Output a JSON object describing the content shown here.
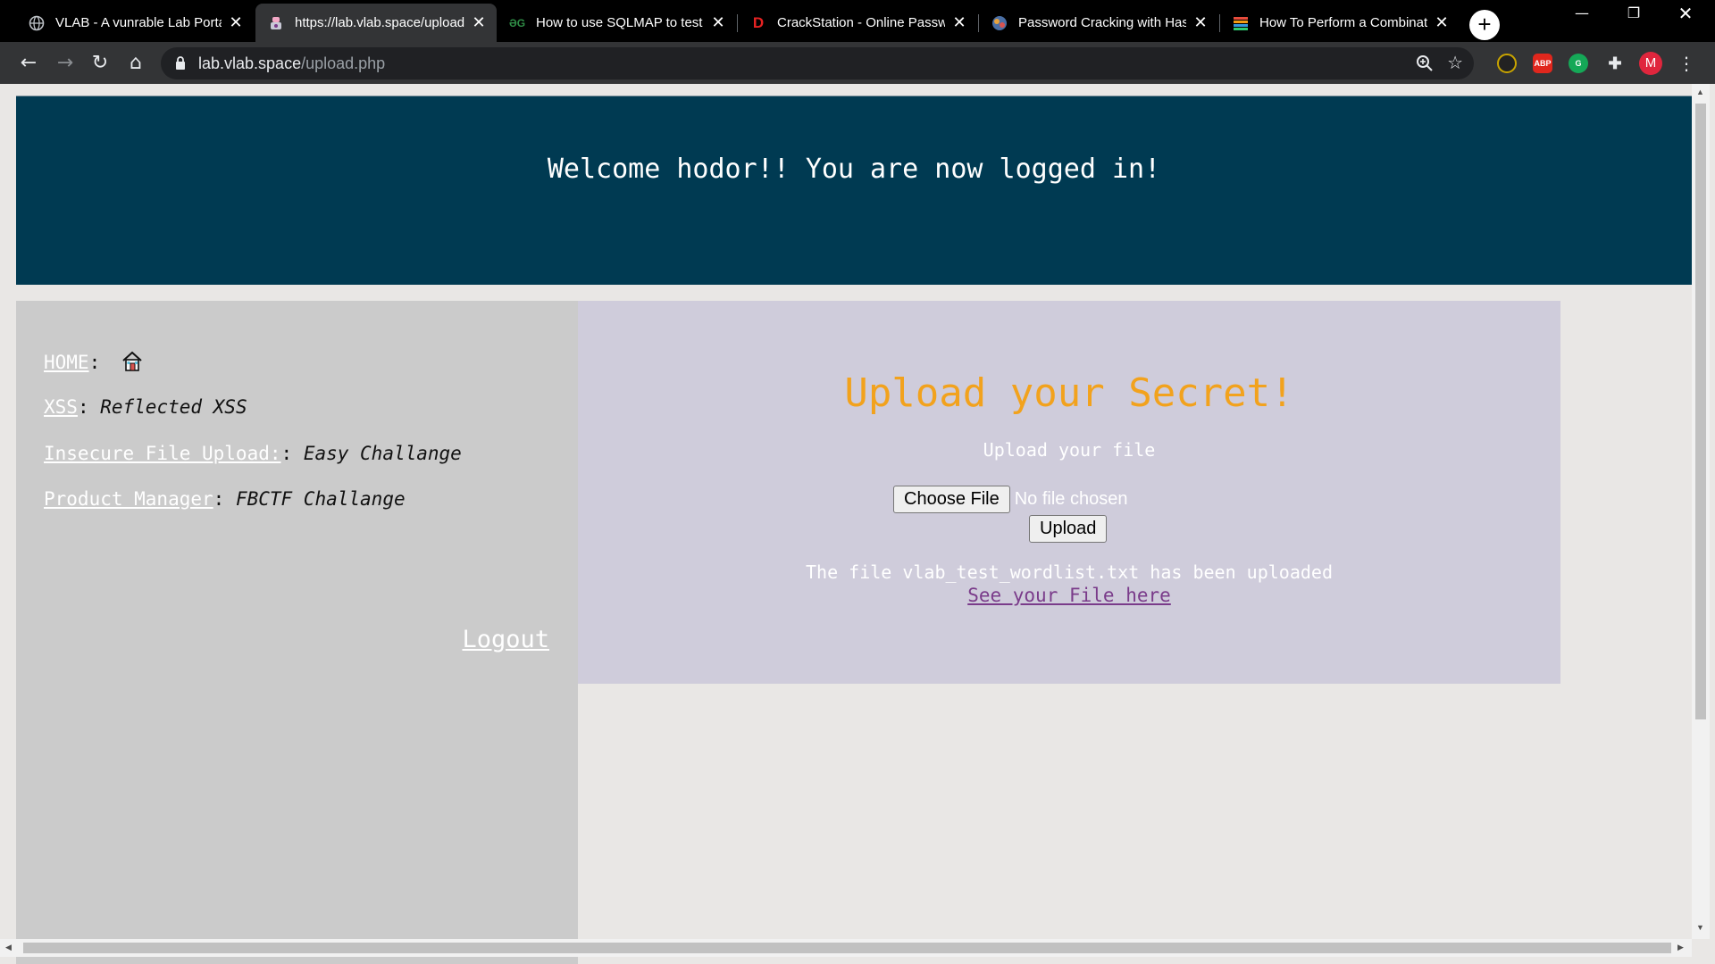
{
  "browser": {
    "tabs": [
      {
        "title": "VLAB - A vunrable Lab Portal",
        "active": false,
        "icon": "globe-icon"
      },
      {
        "title": "https://lab.vlab.space/upload.php",
        "active": true,
        "icon": "lab-icon"
      },
      {
        "title": "How to use SQLMAP to test",
        "active": false,
        "icon": "gfg-icon"
      },
      {
        "title": "CrackStation - Online Password",
        "active": false,
        "icon": "crackstation-icon"
      },
      {
        "title": "Password Cracking with Hashcat",
        "active": false,
        "icon": "hashcat-icon"
      },
      {
        "title": "How To Perform a Combination",
        "active": false,
        "icon": "article-icon"
      }
    ],
    "url_host": "lab.vlab.space",
    "url_path": "/upload.php",
    "profile_initial": "M",
    "extensions": [
      "dark-mode-icon",
      "adblock-icon",
      "grammarly-icon",
      "puzzle-icon"
    ]
  },
  "page": {
    "header": "Welcome hodor!! You are now logged in!",
    "nav": [
      {
        "link": "HOME",
        "desc": ""
      },
      {
        "link": "XSS",
        "desc": "Reflected XSS"
      },
      {
        "link": "Insecure File Upload:",
        "desc": "Easy Challange"
      },
      {
        "link": "Product Manager",
        "desc": "FBCTF Challange"
      }
    ],
    "logout": "Logout",
    "title": "Upload your Secret!",
    "subtitle": "Upload your file",
    "choose_file": "Choose File",
    "no_file": "No file chosen",
    "upload": "Upload",
    "message": "The file vlab_test_wordlist.txt has been uploaded",
    "see_file": "See your File here"
  },
  "colors": {
    "header_bg": "#003a52",
    "title": "#f2a21d",
    "sidebar_bg": "#cbcbcb",
    "content_bg": "#cfccdb",
    "link_visited": "#7a3b8a"
  }
}
